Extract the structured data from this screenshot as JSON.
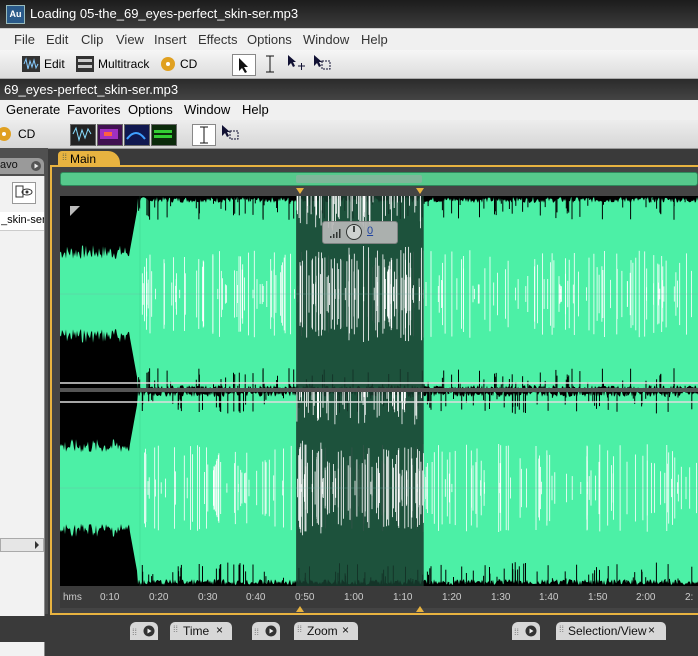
{
  "app_window": {
    "logo": "Au",
    "title": "Loading 05-the_69_eyes-perfect_skin-ser.mp3",
    "menu": [
      "File",
      "Edit",
      "Clip",
      "View",
      "Insert",
      "Effects",
      "Options",
      "Window",
      "Help"
    ],
    "toolbar": {
      "edit_label": "Edit",
      "multitrack_label": "Multitrack",
      "cd_label": "CD"
    }
  },
  "inner_window": {
    "title": "69_eyes-perfect_skin-ser.mp3",
    "menu": [
      "Generate",
      "Favorites",
      "Options",
      "Window",
      "Help"
    ],
    "toolbar": {
      "cd_label": "CD"
    }
  },
  "left_panel": {
    "header": "avo",
    "file_label": "_skin-ser"
  },
  "main_panel": {
    "tab_label": "Main",
    "volume_value": "0",
    "ruler_ticks": [
      "hms",
      "0:10",
      "0:20",
      "0:30",
      "0:40",
      "0:50",
      "1:00",
      "1:10",
      "1:20",
      "1:30",
      "1:40",
      "1:50",
      "2:00",
      "2:"
    ],
    "selection": {
      "start_percent": 0.37,
      "end_percent": 0.57
    }
  },
  "bottom_tabs": [
    "Time",
    "Zoom",
    "Selection/View"
  ],
  "colors": {
    "waveform": "#4cf0a6",
    "selection_bg": "#173b2e",
    "frame_accent": "#e8b340"
  }
}
